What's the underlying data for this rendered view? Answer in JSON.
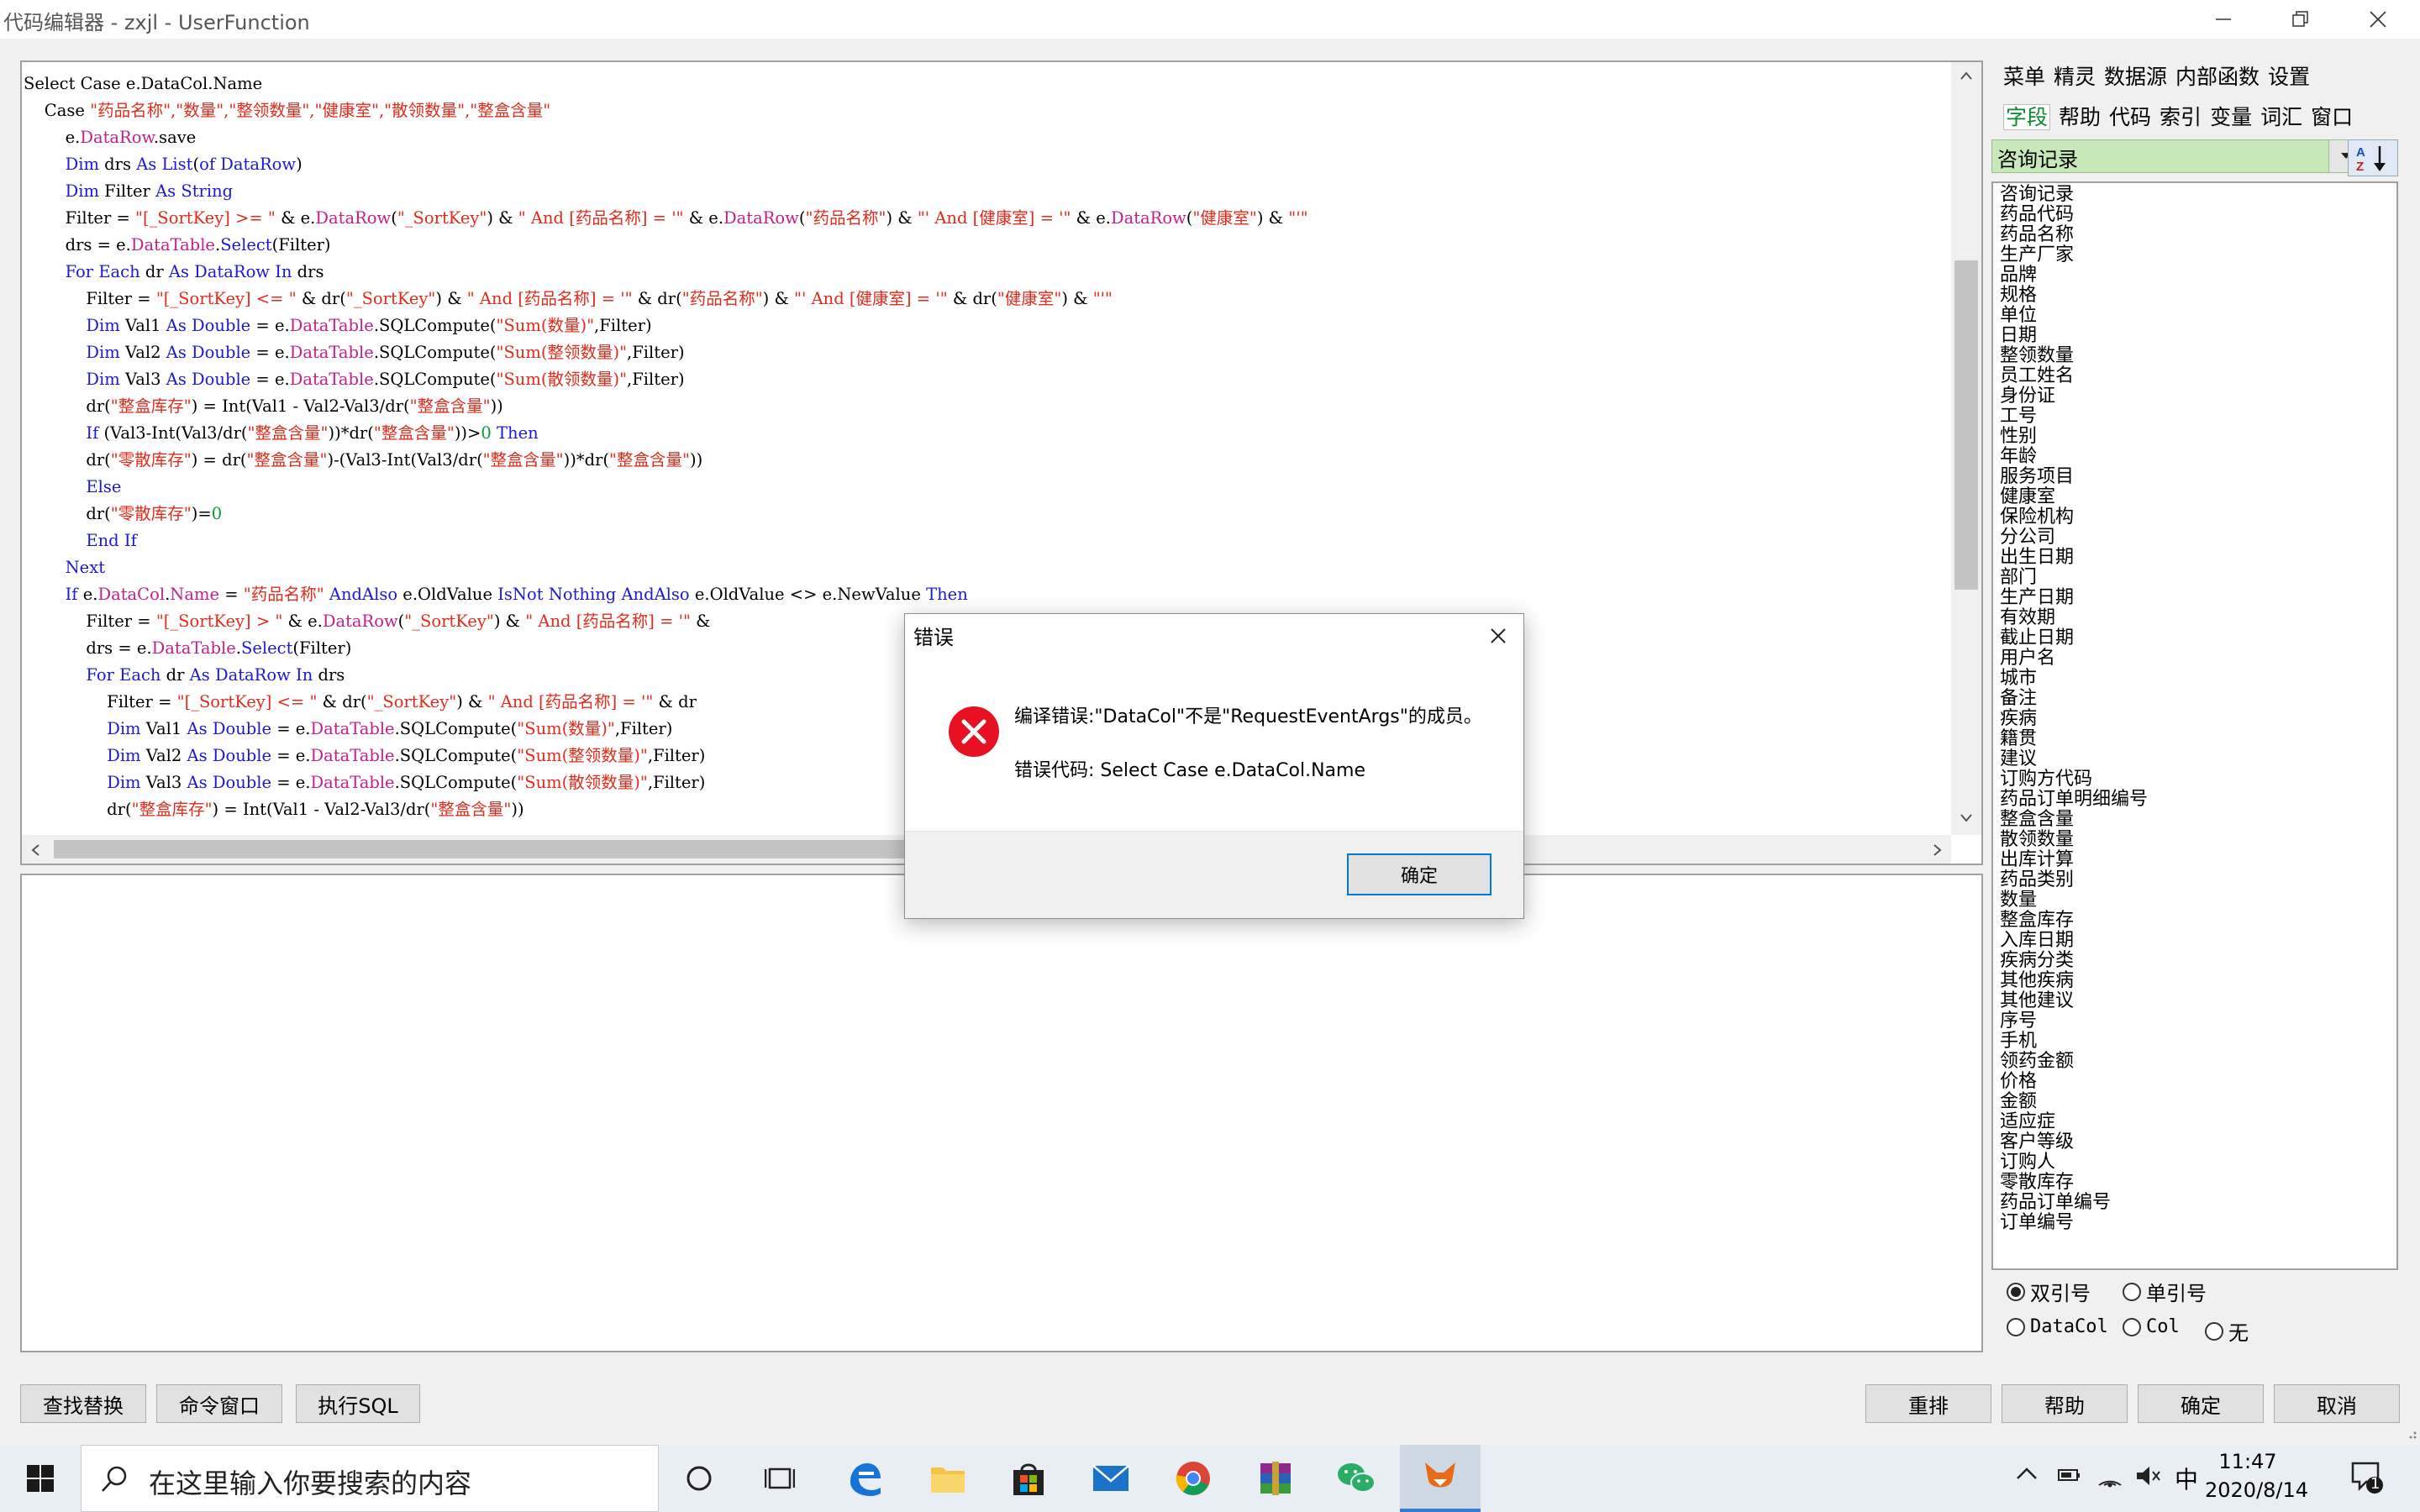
{
  "window": {
    "title": "代码编辑器 - zxjl - UserFunction",
    "controls": [
      "minimize-icon",
      "restore-icon",
      "close-icon"
    ]
  },
  "code": {
    "lines": [
      [
        [
          "",
          "Select Case e.DataCol.Name"
        ]
      ],
      [
        [
          "",
          "    Case "
        ],
        [
          "str",
          "\"药品名称\",\"数量\",\"整领数量\",\"健康室\",\"散领数量\",\"整盒含量\""
        ]
      ],
      [
        [
          "",
          "        e."
        ],
        [
          "prop",
          "DataRow"
        ],
        [
          "",
          ".save"
        ]
      ],
      [
        [
          "",
          "        "
        ],
        [
          "kw",
          "Dim"
        ],
        [
          "",
          " drs "
        ],
        [
          "kw",
          "As List"
        ],
        [
          "",
          "("
        ],
        [
          "kw",
          "of DataRow"
        ],
        [
          "",
          ")"
        ]
      ],
      [
        [
          "",
          "        "
        ],
        [
          "kw",
          "Dim"
        ],
        [
          "",
          " Filter "
        ],
        [
          "kw",
          "As String"
        ]
      ],
      [
        [
          "",
          "        Filter = "
        ],
        [
          "str",
          "\"[_SortKey] >= \""
        ],
        [
          "",
          " & e."
        ],
        [
          "prop",
          "DataRow"
        ],
        [
          "",
          "("
        ],
        [
          "str",
          "\"_SortKey\""
        ],
        [
          "",
          ") & "
        ],
        [
          "str",
          "\" And [药品名称] = '\""
        ],
        [
          "",
          " & e."
        ],
        [
          "prop",
          "DataRow"
        ],
        [
          "",
          "("
        ],
        [
          "str",
          "\"药品名称\""
        ],
        [
          "",
          ") & "
        ],
        [
          "str",
          "\"' And [健康室] = '\""
        ],
        [
          "",
          " & e."
        ],
        [
          "prop",
          "DataRow"
        ],
        [
          "",
          "("
        ],
        [
          "str",
          "\"健康室\""
        ],
        [
          "",
          ") & "
        ],
        [
          "str",
          "\"'\""
        ]
      ],
      [
        [
          "",
          "        drs = e."
        ],
        [
          "prop",
          "DataTable"
        ],
        [
          "",
          "."
        ],
        [
          "kw",
          "Select"
        ],
        [
          "",
          "(Filter)"
        ]
      ],
      [
        [
          "",
          "        "
        ],
        [
          "kw",
          "For Each"
        ],
        [
          "",
          " dr "
        ],
        [
          "kw",
          "As DataRow In"
        ],
        [
          "",
          " drs"
        ]
      ],
      [
        [
          "",
          "            Filter = "
        ],
        [
          "str",
          "\"[_SortKey] <= \""
        ],
        [
          "",
          " & dr("
        ],
        [
          "str",
          "\"_SortKey\""
        ],
        [
          "",
          ") & "
        ],
        [
          "str",
          "\" And [药品名称] = '\""
        ],
        [
          "",
          " & dr("
        ],
        [
          "str",
          "\"药品名称\""
        ],
        [
          "",
          ") & "
        ],
        [
          "str",
          "\"' And [健康室] = '\""
        ],
        [
          "",
          " & dr("
        ],
        [
          "str",
          "\"健康室\""
        ],
        [
          "",
          ") & "
        ],
        [
          "str",
          "\"'\""
        ]
      ],
      [
        [
          "",
          "            "
        ],
        [
          "kw",
          "Dim"
        ],
        [
          "",
          " Val1 "
        ],
        [
          "kw",
          "As Double"
        ],
        [
          "",
          " = e."
        ],
        [
          "prop",
          "DataTable"
        ],
        [
          "",
          ".SQLCompute("
        ],
        [
          "str",
          "\"Sum(数量)\""
        ],
        [
          "",
          ",Filter)"
        ]
      ],
      [
        [
          "",
          "            "
        ],
        [
          "kw",
          "Dim"
        ],
        [
          "",
          " Val2 "
        ],
        [
          "kw",
          "As Double"
        ],
        [
          "",
          " = e."
        ],
        [
          "prop",
          "DataTable"
        ],
        [
          "",
          ".SQLCompute("
        ],
        [
          "str",
          "\"Sum(整领数量)\""
        ],
        [
          "",
          ",Filter)"
        ]
      ],
      [
        [
          "",
          "            "
        ],
        [
          "kw",
          "Dim"
        ],
        [
          "",
          " Val3 "
        ],
        [
          "kw",
          "As Double"
        ],
        [
          "",
          " = e."
        ],
        [
          "prop",
          "DataTable"
        ],
        [
          "",
          ".SQLCompute("
        ],
        [
          "str",
          "\"Sum(散领数量)\""
        ],
        [
          "",
          ",Filter)"
        ]
      ],
      [
        [
          "",
          "            dr("
        ],
        [
          "str",
          "\"整盒库存\""
        ],
        [
          "",
          ") = Int(Val1 - Val2-Val3/dr("
        ],
        [
          "str",
          "\"整盒含量\""
        ],
        [
          "",
          "))"
        ]
      ],
      [
        [
          "",
          "            "
        ],
        [
          "kw",
          "If"
        ],
        [
          "",
          " (Val3-Int(Val3/dr("
        ],
        [
          "str",
          "\"整盒含量\""
        ],
        [
          "",
          "))*dr("
        ],
        [
          "str",
          "\"整盒含量\""
        ],
        [
          "",
          "))>"
        ],
        [
          "num",
          "0"
        ],
        [
          "kw",
          " Then"
        ]
      ],
      [
        [
          "",
          "            dr("
        ],
        [
          "str",
          "\"零散库存\""
        ],
        [
          "",
          ") = dr("
        ],
        [
          "str",
          "\"整盒含量\""
        ],
        [
          "",
          ")-(Val3-Int(Val3/dr("
        ],
        [
          "str",
          "\"整盒含量\""
        ],
        [
          "",
          "))*dr("
        ],
        [
          "str",
          "\"整盒含量\""
        ],
        [
          "",
          "))"
        ]
      ],
      [
        [
          "",
          "            "
        ],
        [
          "kw",
          "Else"
        ]
      ],
      [
        [
          "",
          "            dr("
        ],
        [
          "str",
          "\"零散库存\""
        ],
        [
          "",
          ")="
        ],
        [
          "num",
          "0"
        ]
      ],
      [
        [
          "",
          "            "
        ],
        [
          "kw",
          "End If"
        ]
      ],
      [
        [
          "",
          "        "
        ],
        [
          "kw",
          "Next"
        ]
      ],
      [
        [
          "",
          "        "
        ],
        [
          "kw",
          "If"
        ],
        [
          "",
          " e."
        ],
        [
          "prop",
          "DataCol"
        ],
        [
          "",
          "."
        ],
        [
          "prop",
          "Name"
        ],
        [
          "",
          " = "
        ],
        [
          "str",
          "\"药品名称\""
        ],
        [
          "",
          ""
        ],
        [
          "kw",
          " AndAlso"
        ],
        [
          "",
          " e.OldValue "
        ],
        [
          "kw",
          "IsNot Nothing AndAlso"
        ],
        [
          "",
          " e.OldValue <> e.NewValue "
        ],
        [
          "kw",
          "Then"
        ]
      ],
      [
        [
          "",
          "            Filter = "
        ],
        [
          "str",
          "\"[_SortKey] > \""
        ],
        [
          "",
          " & e."
        ],
        [
          "prop",
          "DataRow"
        ],
        [
          "",
          "("
        ],
        [
          "str",
          "\"_SortKey\""
        ],
        [
          "",
          ") & "
        ],
        [
          "str",
          "\" And [药品名称] = '\""
        ],
        [
          "",
          " & "
        ]
      ],
      [
        [
          "",
          "            drs = e."
        ],
        [
          "prop",
          "DataTable"
        ],
        [
          "",
          "."
        ],
        [
          "kw",
          "Select"
        ],
        [
          "",
          "(Filter)"
        ]
      ],
      [
        [
          "",
          "            "
        ],
        [
          "kw",
          "For Each"
        ],
        [
          "",
          " dr "
        ],
        [
          "kw",
          "As DataRow In"
        ],
        [
          "",
          " drs"
        ]
      ],
      [
        [
          "",
          "                Filter = "
        ],
        [
          "str",
          "\"[_SortKey] <= \""
        ],
        [
          "",
          " & dr("
        ],
        [
          "str",
          "\"_SortKey\""
        ],
        [
          "",
          ") & "
        ],
        [
          "str",
          "\" And [药品名称] = '\""
        ],
        [
          "",
          " & dr"
        ]
      ],
      [
        [
          "",
          "                "
        ],
        [
          "kw",
          "Dim"
        ],
        [
          "",
          " Val1 "
        ],
        [
          "kw",
          "As Double"
        ],
        [
          "",
          " = e."
        ],
        [
          "prop",
          "DataTable"
        ],
        [
          "",
          ".SQLCompute("
        ],
        [
          "str",
          "\"Sum(数量)\""
        ],
        [
          "",
          ",Filter)"
        ]
      ],
      [
        [
          "",
          "                "
        ],
        [
          "kw",
          "Dim"
        ],
        [
          "",
          " Val2 "
        ],
        [
          "kw",
          "As Double"
        ],
        [
          "",
          " = e."
        ],
        [
          "prop",
          "DataTable"
        ],
        [
          "",
          ".SQLCompute("
        ],
        [
          "str",
          "\"Sum(整领数量)\""
        ],
        [
          "",
          ",Filter)"
        ]
      ],
      [
        [
          "",
          "                "
        ],
        [
          "kw",
          "Dim"
        ],
        [
          "",
          " Val3 "
        ],
        [
          "kw",
          "As Double"
        ],
        [
          "",
          " = e."
        ],
        [
          "prop",
          "DataTable"
        ],
        [
          "",
          ".SQLCompute("
        ],
        [
          "str",
          "\"Sum(散领数量)\""
        ],
        [
          "",
          ",Filter)"
        ]
      ],
      [
        [
          "",
          "                dr("
        ],
        [
          "str",
          "\"整盒库存\""
        ],
        [
          "",
          ") = Int(Val1 - Val2-Val3/dr("
        ],
        [
          "str",
          "\"整盒含量\""
        ],
        [
          "",
          "))"
        ]
      ]
    ]
  },
  "panel": {
    "menu_row1": [
      "菜单",
      "精灵",
      "数据源",
      "内部函数",
      "设置"
    ],
    "menu_row2": [
      "字段",
      "帮助",
      "代码",
      "索引",
      "变量",
      "词汇",
      "窗口"
    ],
    "active_tab": "字段",
    "table_select": "咨询记录",
    "fields": [
      "咨询记录",
      "药品代码",
      "药品名称",
      "生产厂家",
      "品牌",
      "规格",
      "单位",
      "日期",
      "整领数量",
      "员工姓名",
      "身份证",
      "工号",
      "性别",
      "年龄",
      "服务项目",
      "健康室",
      "保险机构",
      "分公司",
      "出生日期",
      "部门",
      "生产日期",
      "有效期",
      "截止日期",
      "用户名",
      "城市",
      "备注",
      "疾病",
      "籍贯",
      "建议",
      "订购方代码",
      "药品订单明细编号",
      "整盒含量",
      "散领数量",
      "出库计算",
      "药品类别",
      "数量",
      "整盒库存",
      "入库日期",
      "疾病分类",
      "其他疾病",
      "其他建议",
      "序号",
      "手机",
      "领药金额",
      "价格",
      "金额",
      "适应症",
      "客户等级",
      "订购人",
      "零散库存",
      "药品订单编号",
      "订单编号"
    ],
    "quote_options": [
      "双引号",
      "单引号"
    ],
    "quote_selected": "双引号",
    "ref_options": [
      "DataCol",
      "Col",
      "无"
    ]
  },
  "buttons": {
    "find_replace": "查找替换",
    "command_window": "命令窗口",
    "run_sql": "执行SQL",
    "reorder": "重排",
    "help": "帮助",
    "ok": "确定",
    "cancel": "取消"
  },
  "dialog": {
    "title": "错误",
    "message": "编译错误:\"DataCol\"不是\"RequestEventArgs\"的成员。",
    "code_line": "错误代码:  Select Case e.DataCol.Name",
    "ok_label": "确定",
    "icon": "error-icon"
  },
  "taskbar": {
    "search_placeholder": "在这里输入你要搜索的内容",
    "time": "11:47",
    "date": "2020/8/14",
    "ime": "中",
    "notification_count": "1"
  },
  "colors": {
    "keyword": "#1a1ad6",
    "string": "#e12b1c",
    "property": "#c2208a",
    "number": "#0a9a3a",
    "field_selector": "#c7e8b8",
    "active_tab": "#0a8a2a"
  }
}
